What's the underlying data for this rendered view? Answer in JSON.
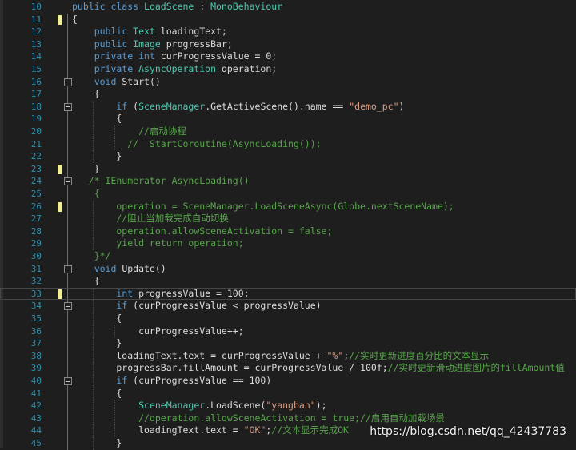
{
  "colors": {
    "background": "#1e1e1e",
    "line_number": "#2b91af",
    "keyword": "#569cd6",
    "type": "#4ec9b0",
    "string": "#d69d85",
    "comment": "#57a64a",
    "plain": "#dcdcdc",
    "number": "#b5cea8",
    "change_marker": "#efef9b"
  },
  "editor": {
    "lines": [
      {
        "n": "10",
        "fold": false,
        "changed": false,
        "tokens": [
          [
            "keyword",
            "public class "
          ],
          [
            "type",
            "LoadScene"
          ],
          [
            "plain",
            " : "
          ],
          [
            "type",
            "MonoBehaviour"
          ]
        ]
      },
      {
        "n": "11",
        "fold": false,
        "changed": true,
        "tokens": [
          [
            "plain",
            "{"
          ]
        ]
      },
      {
        "n": "12",
        "fold": false,
        "changed": false,
        "tokens": [
          [
            "plain",
            "    "
          ],
          [
            "keyword",
            "public "
          ],
          [
            "type",
            "Text"
          ],
          [
            "plain",
            " loadingText;"
          ]
        ]
      },
      {
        "n": "13",
        "fold": false,
        "changed": false,
        "tokens": [
          [
            "plain",
            "    "
          ],
          [
            "keyword",
            "public "
          ],
          [
            "type",
            "Image"
          ],
          [
            "plain",
            " progressBar;"
          ]
        ]
      },
      {
        "n": "14",
        "fold": false,
        "changed": false,
        "tokens": [
          [
            "plain",
            "    "
          ],
          [
            "keyword",
            "private int "
          ],
          [
            "plain",
            "curProgressValue = 0;"
          ]
        ]
      },
      {
        "n": "15",
        "fold": false,
        "changed": false,
        "tokens": [
          [
            "plain",
            "    "
          ],
          [
            "keyword",
            "private "
          ],
          [
            "type",
            "AsyncOperation"
          ],
          [
            "plain",
            " operation;"
          ]
        ]
      },
      {
        "n": "16",
        "fold": true,
        "changed": false,
        "tokens": [
          [
            "plain",
            "    "
          ],
          [
            "keyword",
            "void "
          ],
          [
            "plain",
            "Start()"
          ]
        ]
      },
      {
        "n": "17",
        "fold": false,
        "changed": false,
        "tokens": [
          [
            "plain",
            "    {"
          ]
        ]
      },
      {
        "n": "18",
        "fold": true,
        "changed": false,
        "tokens": [
          [
            "plain",
            "        "
          ],
          [
            "keyword",
            "if "
          ],
          [
            "plain",
            "("
          ],
          [
            "type",
            "SceneManager"
          ],
          [
            "plain",
            ".GetActiveScene().name == "
          ],
          [
            "string",
            "\"demo_pc\""
          ],
          [
            "plain",
            ")"
          ]
        ]
      },
      {
        "n": "19",
        "fold": false,
        "changed": false,
        "tokens": [
          [
            "plain",
            "        {"
          ]
        ]
      },
      {
        "n": "20",
        "fold": false,
        "changed": false,
        "tokens": [
          [
            "comment",
            "            //启动协程"
          ]
        ]
      },
      {
        "n": "21",
        "fold": false,
        "changed": false,
        "tokens": [
          [
            "comment",
            "          //  StartCoroutine(AsyncLoading());"
          ]
        ]
      },
      {
        "n": "22",
        "fold": false,
        "changed": false,
        "tokens": [
          [
            "plain",
            "        }"
          ]
        ]
      },
      {
        "n": "23",
        "fold": false,
        "changed": true,
        "tokens": [
          [
            "plain",
            "    }"
          ]
        ]
      },
      {
        "n": "24",
        "fold": true,
        "changed": false,
        "tokens": [
          [
            "comment",
            "   /* IEnumerator AsyncLoading()"
          ]
        ]
      },
      {
        "n": "25",
        "fold": false,
        "changed": false,
        "tokens": [
          [
            "comment",
            "    {"
          ]
        ]
      },
      {
        "n": "26",
        "fold": false,
        "changed": true,
        "tokens": [
          [
            "comment",
            "        operation = SceneManager.LoadSceneAsync(Globe.nextSceneName);"
          ]
        ]
      },
      {
        "n": "27",
        "fold": false,
        "changed": false,
        "tokens": [
          [
            "comment",
            "        //阻止当加载完成自动切换"
          ]
        ]
      },
      {
        "n": "28",
        "fold": false,
        "changed": false,
        "tokens": [
          [
            "comment",
            "        operation.allowSceneActivation = false;"
          ]
        ]
      },
      {
        "n": "29",
        "fold": false,
        "changed": false,
        "tokens": [
          [
            "comment",
            "        yield return operation;"
          ]
        ]
      },
      {
        "n": "30",
        "fold": false,
        "changed": false,
        "tokens": [
          [
            "comment",
            "    }*/"
          ]
        ]
      },
      {
        "n": "31",
        "fold": true,
        "changed": false,
        "tokens": [
          [
            "plain",
            "    "
          ],
          [
            "keyword",
            "void "
          ],
          [
            "plain",
            "Update()"
          ]
        ]
      },
      {
        "n": "32",
        "fold": false,
        "changed": false,
        "tokens": [
          [
            "plain",
            "    {"
          ]
        ]
      },
      {
        "n": "33",
        "fold": false,
        "changed": true,
        "current": true,
        "tokens": [
          [
            "plain",
            "        "
          ],
          [
            "keyword",
            "int "
          ],
          [
            "plain",
            "progressValue = 100;"
          ]
        ]
      },
      {
        "n": "34",
        "fold": true,
        "changed": false,
        "tokens": [
          [
            "plain",
            "        "
          ],
          [
            "keyword",
            "if "
          ],
          [
            "plain",
            "(curProgressValue < progressValue)"
          ]
        ]
      },
      {
        "n": "35",
        "fold": false,
        "changed": false,
        "tokens": [
          [
            "plain",
            "        {"
          ]
        ]
      },
      {
        "n": "36",
        "fold": false,
        "changed": false,
        "tokens": [
          [
            "plain",
            "            curProgressValue++;"
          ]
        ]
      },
      {
        "n": "37",
        "fold": false,
        "changed": false,
        "tokens": [
          [
            "plain",
            "        }"
          ]
        ]
      },
      {
        "n": "38",
        "fold": false,
        "changed": false,
        "tokens": [
          [
            "plain",
            "        loadingText.text = curProgressValue + "
          ],
          [
            "string",
            "\"%\""
          ],
          [
            "plain",
            ";"
          ],
          [
            "comment",
            "//实时更新进度百分比的文本显示"
          ]
        ]
      },
      {
        "n": "39",
        "fold": false,
        "changed": false,
        "tokens": [
          [
            "plain",
            "        progressBar.fillAmount = curProgressValue / 100f;"
          ],
          [
            "comment",
            "//实时更新滑动进度图片的fillAmount值"
          ]
        ]
      },
      {
        "n": "40",
        "fold": true,
        "changed": false,
        "tokens": [
          [
            "plain",
            "        "
          ],
          [
            "keyword",
            "if "
          ],
          [
            "plain",
            "(curProgressValue == 100)"
          ]
        ]
      },
      {
        "n": "41",
        "fold": false,
        "changed": false,
        "tokens": [
          [
            "plain",
            "        {"
          ]
        ]
      },
      {
        "n": "42",
        "fold": false,
        "changed": false,
        "tokens": [
          [
            "plain",
            "            "
          ],
          [
            "type",
            "SceneManager"
          ],
          [
            "plain",
            ".LoadScene("
          ],
          [
            "string",
            "\"yangban\""
          ],
          [
            "plain",
            ");"
          ]
        ]
      },
      {
        "n": "43",
        "fold": false,
        "changed": false,
        "tokens": [
          [
            "comment",
            "            //operation.allowSceneActivation = true;//启用自动加载场景"
          ]
        ]
      },
      {
        "n": "44",
        "fold": false,
        "changed": false,
        "tokens": [
          [
            "plain",
            "            loadingText.text = "
          ],
          [
            "string",
            "\"OK\""
          ],
          [
            "plain",
            ";"
          ],
          [
            "comment",
            "//文本显示完成OK"
          ]
        ]
      },
      {
        "n": "45",
        "fold": false,
        "changed": false,
        "tokens": [
          [
            "plain",
            "        }"
          ]
        ]
      }
    ]
  },
  "watermark": "https://blog.csdn.net/qq_42437783"
}
